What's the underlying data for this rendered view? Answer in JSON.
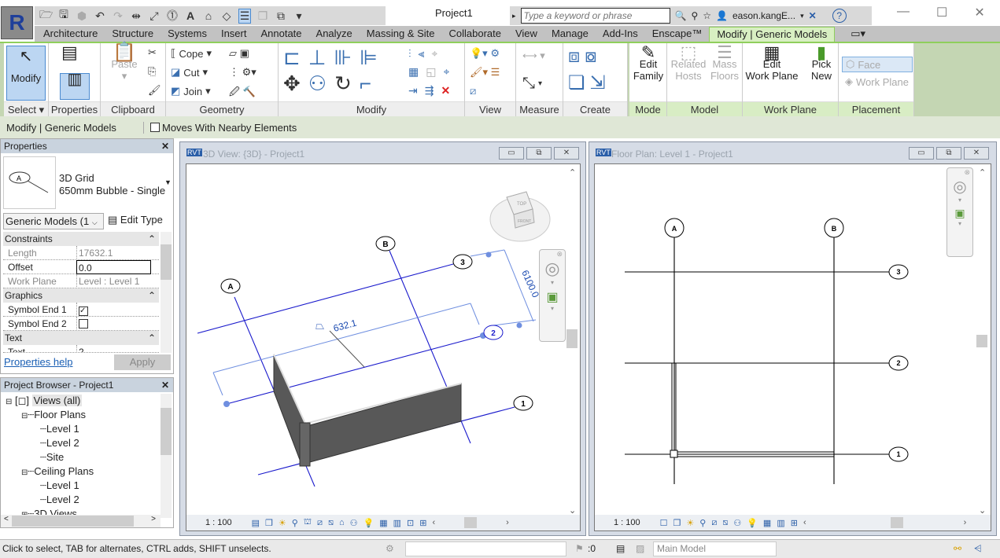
{
  "app": {
    "title": "Project1",
    "logo": "R"
  },
  "qat": {
    "icons": [
      "open-icon",
      "save-icon",
      "sync-icon",
      "undo-icon",
      "redo-icon",
      "measure-icon",
      "aligned-dimension-icon",
      "tag-icon",
      "text-icon",
      "3d-view-icon",
      "section-icon",
      "thin-lines-icon",
      "close-hidden-icon",
      "switch-windows-icon",
      "customize-icon"
    ]
  },
  "search": {
    "placeholder": "Type a keyword or phrase",
    "user": "eason.kangE...",
    "help": "?"
  },
  "tabs": [
    "Architecture",
    "Structure",
    "Systems",
    "Insert",
    "Annotate",
    "Analyze",
    "Massing & Site",
    "Collaborate",
    "View",
    "Manage",
    "Add-Ins",
    "Enscape™",
    "Modify | Generic Models"
  ],
  "active_tab": "Modify | Generic Models",
  "ribbon": {
    "panels": [
      "Select",
      "Properties",
      "Clipboard",
      "Geometry",
      "Modify",
      "View",
      "Measure",
      "Create",
      "Mode",
      "Model",
      "Work Plane",
      "Placement"
    ],
    "modify": "Modify",
    "paste": "Paste",
    "cope": "Cope",
    "cut": "Cut",
    "join": "Join",
    "edit_family": [
      "Edit",
      "Family"
    ],
    "related_hosts": [
      "Related",
      "Hosts"
    ],
    "mass_floors": [
      "Mass",
      "Floors"
    ],
    "edit_work_plane": [
      "Edit",
      "Work Plane"
    ],
    "pick_new": [
      "Pick",
      "New"
    ],
    "face": "Face",
    "work_plane": "Work Plane"
  },
  "options_bar": {
    "context": "Modify | Generic Models",
    "moves_with_nearby": "Moves With Nearby Elements",
    "moves_checked": false
  },
  "properties": {
    "title": "Properties",
    "type_name": "3D Grid",
    "type_sub": "650mm Bubble - Single",
    "selector": "Generic Models (1",
    "edit_type": "Edit Type",
    "groups": {
      "constraints": "Constraints",
      "graphics": "Graphics",
      "text": "Text"
    },
    "rows": [
      {
        "k": "Length",
        "v": "17632.1"
      },
      {
        "k": "Offset",
        "v": "0.0"
      },
      {
        "k": "Work Plane",
        "v": "Level : Level 1"
      },
      {
        "k": "Symbol End 1",
        "checked": true
      },
      {
        "k": "Symbol End 2",
        "checked": false
      },
      {
        "k": "Text",
        "v": "2"
      }
    ],
    "help": "Properties help",
    "apply": "Apply"
  },
  "browser": {
    "title": "Project Browser - Project1",
    "items": [
      "Views (all)",
      "Floor Plans",
      "Level 1",
      "Level 2",
      "Site",
      "Ceiling Plans",
      "Level 1",
      "Level 2",
      "3D Views"
    ]
  },
  "view3d": {
    "title": "3D View: {3D} - Project1",
    "scale": "1 : 100",
    "grids": [
      "A",
      "B",
      "3",
      "2",
      "1"
    ],
    "dim1": "6100.0",
    "dim2": "632.1",
    "cube_top": "TOP",
    "cube_front": "FRONT"
  },
  "viewplan": {
    "title": "Floor Plan: Level 1 - Project1",
    "scale": "1 : 100",
    "grids": [
      "A",
      "B",
      "3",
      "2",
      "1"
    ]
  },
  "status": {
    "message": "Click to select, TAB for alternates, CTRL adds, SHIFT unselects.",
    "zero": ":0",
    "model": "Main Model"
  },
  "colors": {
    "grid_blue": "#1a1acc",
    "dim_blue": "#6f8fe0",
    "wall": "#585858",
    "ribbon_green": "#8fcf5c"
  }
}
